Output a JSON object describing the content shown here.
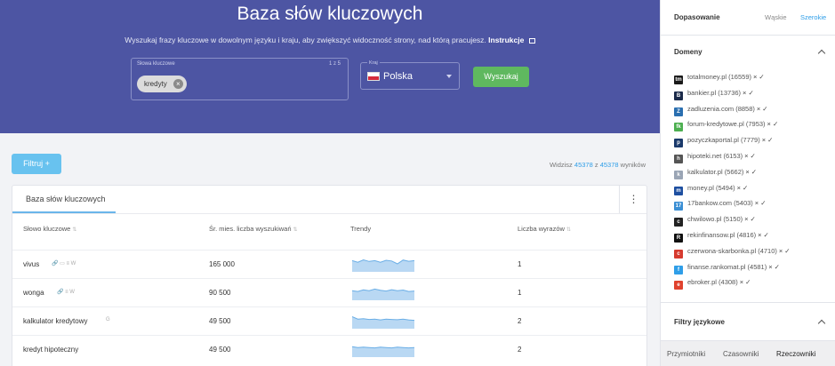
{
  "hero": {
    "title": "Baza słów kluczowych",
    "subtitle": "Wyszukaj frazy kluczowe w dowolnym języku i kraju, aby zwiększyć widoczność strony, nad którą pracujesz.",
    "instructions_link": "Instrukcje",
    "keyword_field": {
      "label": "Słowa kluczowe",
      "counter": "1 z 5",
      "chip": "kredyty"
    },
    "country_field": {
      "label": "Kraj",
      "value": "Polska"
    },
    "search_button": "Wyszukaj"
  },
  "filter_button": "Filtruj +",
  "results": {
    "prefix": "Widzisz",
    "shown": "45378",
    "of": "z",
    "total": "45378",
    "suffix": "wyników"
  },
  "card": {
    "tab": "Baza słów kluczowych",
    "menu_icon": "⋮",
    "columns": [
      "Słowo kluczowe",
      "Śr. mies. liczba wyszukiwań",
      "Trendy",
      "Liczba wyrazów"
    ],
    "rows": [
      {
        "keyword": "vivus",
        "icons": "🔗 ▭ ≡ W",
        "searches": "165 000",
        "trend": [
          0.7,
          0.6,
          0.75,
          0.65,
          0.7,
          0.6,
          0.72,
          0.68,
          0.5,
          0.74,
          0.66,
          0.7
        ],
        "words": "1"
      },
      {
        "keyword": "wonga",
        "icons": "🔗 ≡ W",
        "searches": "90 500",
        "trend": [
          0.6,
          0.55,
          0.65,
          0.6,
          0.7,
          0.62,
          0.58,
          0.66,
          0.6,
          0.64,
          0.55,
          0.58
        ],
        "words": "1"
      },
      {
        "keyword": "kalkulator kredytowy",
        "icons": "G",
        "searches": "49 500",
        "trend": [
          0.75,
          0.6,
          0.62,
          0.58,
          0.6,
          0.55,
          0.6,
          0.58,
          0.56,
          0.6,
          0.55,
          0.52
        ],
        "words": "2"
      },
      {
        "keyword": "kredyt hipoteczny",
        "icons": "",
        "searches": "49 500",
        "trend": [
          0.65,
          0.6,
          0.62,
          0.6,
          0.58,
          0.62,
          0.6,
          0.58,
          0.62,
          0.6,
          0.58,
          0.6
        ],
        "words": "2"
      }
    ]
  },
  "panel": {
    "match_label": "Dopasowanie",
    "match_narrow": "Wąskie",
    "match_wide": "Szerokie",
    "domains_title": "Domeny",
    "domains": [
      {
        "name": "totalmoney.pl (16559)",
        "icon_color": "#1a1a1a",
        "glyph": "tm"
      },
      {
        "name": "bankier.pl (13736)",
        "icon_color": "#1b2a4a",
        "glyph": "B"
      },
      {
        "name": "zadluzenia.com (8858)",
        "icon_color": "#2a6fb0",
        "glyph": "Z"
      },
      {
        "name": "forum-kredytowe.pl (7953)",
        "icon_color": "#4caf50",
        "glyph": "fk"
      },
      {
        "name": "pozyczkaportal.pl (7779)",
        "icon_color": "#1b3a6b",
        "glyph": "p"
      },
      {
        "name": "hipoteki.net (6153)",
        "icon_color": "#555555",
        "glyph": "h"
      },
      {
        "name": "kalkulator.pl (5662)",
        "icon_color": "#9aa5b5",
        "glyph": "k"
      },
      {
        "name": "money.pl (5494)",
        "icon_color": "#1e4fa0",
        "glyph": "m"
      },
      {
        "name": "17bankow.com (5403)",
        "icon_color": "#3b8fd4",
        "glyph": "17"
      },
      {
        "name": "chwilowo.pl (5150)",
        "icon_color": "#222222",
        "glyph": "c"
      },
      {
        "name": "rekinfinansow.pl (4816)",
        "icon_color": "#111111",
        "glyph": "R"
      },
      {
        "name": "czerwona-skarbonka.pl (4710)",
        "icon_color": "#d63b2f",
        "glyph": "c"
      },
      {
        "name": "finanse.rankomat.pl (4581)",
        "icon_color": "#2f9ee8",
        "glyph": "f"
      },
      {
        "name": "ebroker.pl (4308)",
        "icon_color": "#e0422e",
        "glyph": "e"
      }
    ],
    "mark_exclude": "×",
    "mark_include": "✓",
    "lang_title": "Filtry językowe",
    "tabs": [
      "Przymiotniki",
      "Czasowniki",
      "Rzeczowniki"
    ]
  }
}
